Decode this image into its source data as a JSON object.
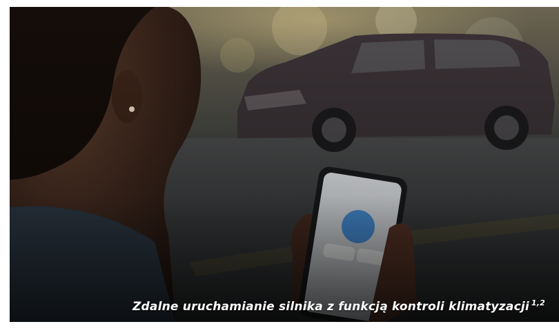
{
  "caption": {
    "text": "Zdalne uruchamianie silnika z funkcją kontroli klimatyzacji",
    "footnote": "1,2"
  },
  "colors": {
    "overlay": "#1c1f22",
    "caption_text": "#ffffff",
    "phone_accent": "#3a8ee0"
  },
  "scene": {
    "subjects": [
      "woman-holding-phone",
      "dark-suv",
      "street-background"
    ]
  }
}
